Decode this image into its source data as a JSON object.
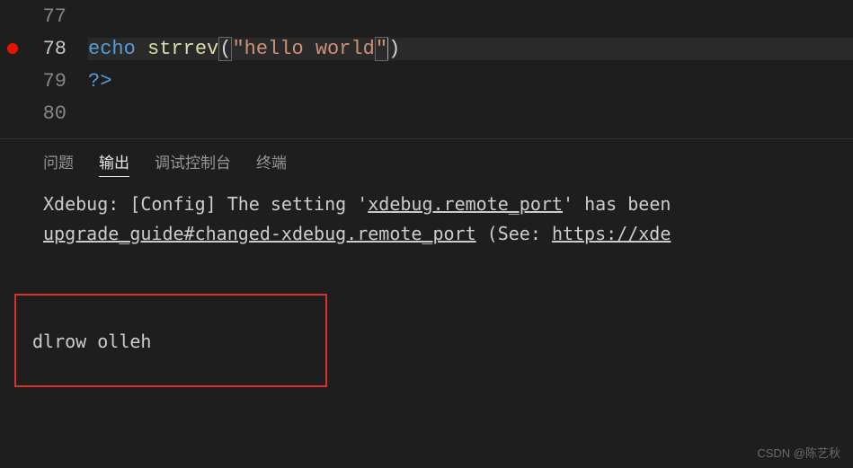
{
  "editor": {
    "lines": [
      {
        "num": "77",
        "active": false,
        "breakpoint": false,
        "tokens": []
      },
      {
        "num": "78",
        "active": true,
        "breakpoint": true,
        "tokens": [
          {
            "cls": "tok-keyword",
            "t": "echo "
          },
          {
            "cls": "tok-func",
            "t": "strrev"
          },
          {
            "cls": "tok-punc bracket-box",
            "t": "("
          },
          {
            "cls": "tok-string",
            "t": "\"hello world"
          },
          {
            "cls": "tok-string bracket-box",
            "t": "\""
          },
          {
            "cls": "tok-punc",
            "t": ")"
          }
        ],
        "cursorAfter": 4
      },
      {
        "num": "79",
        "active": false,
        "breakpoint": false,
        "tokens": [
          {
            "cls": "tok-keyword",
            "t": "?>"
          }
        ]
      },
      {
        "num": "80",
        "active": false,
        "breakpoint": false,
        "tokens": []
      }
    ]
  },
  "panel": {
    "tabs": {
      "problems": "问题",
      "output": "输出",
      "debug": "调试控制台",
      "terminal": "终端"
    },
    "activeTab": "output",
    "outputLines": {
      "l1a": "Xdebug: [Config] The setting '",
      "l1b": "xdebug.remote_port",
      "l1c": "' has been",
      "l2a": "upgrade_guide#changed-xdebug.remote_port",
      "l2b": " (See: ",
      "l2c": "https://xde"
    },
    "resultBox": "dlrow olleh"
  },
  "watermark": "CSDN @陈艺秋"
}
